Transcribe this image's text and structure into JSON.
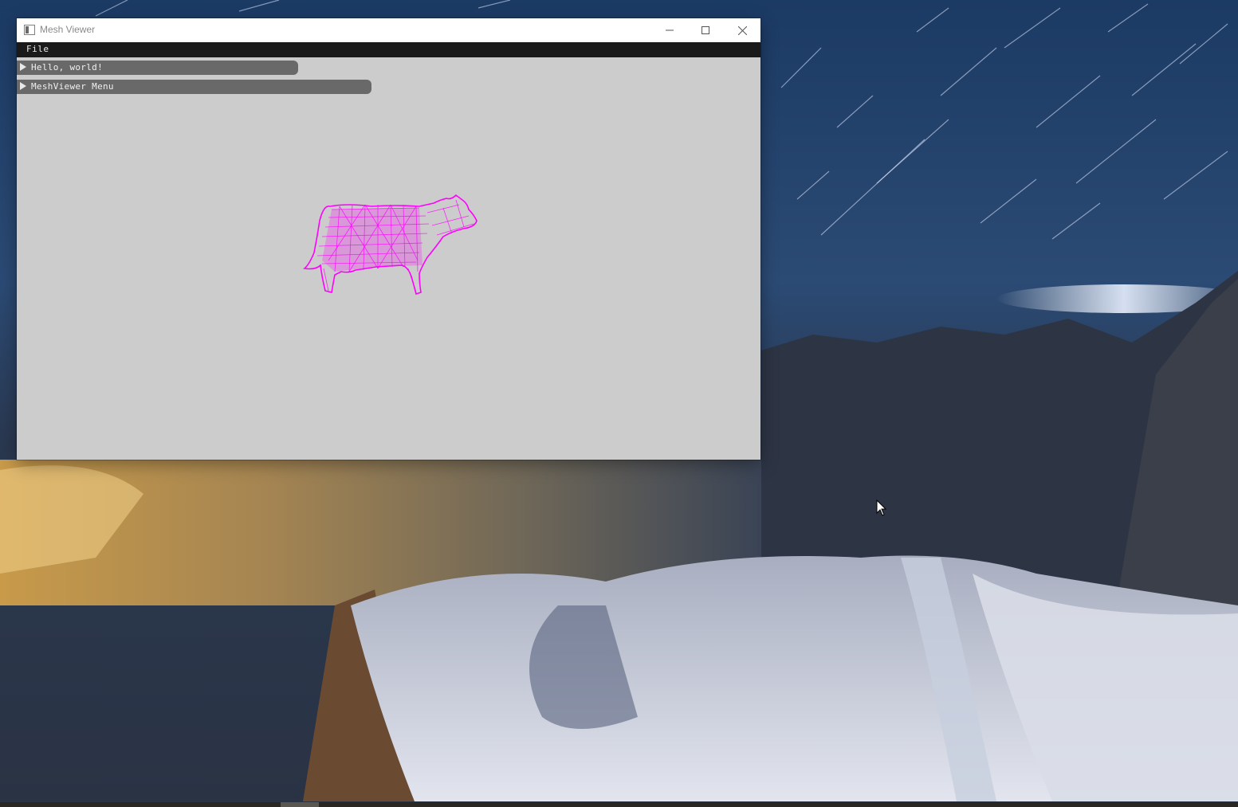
{
  "window": {
    "title": "Mesh Viewer"
  },
  "menubar": {
    "file_label": "File"
  },
  "panels": {
    "hello_label": "Hello, world!",
    "meshviewer_label": "MeshViewer Menu"
  },
  "viewport": {
    "background_color": "#cccccc",
    "mesh_color": "#ff00ff",
    "mesh_render_mode": "wireframe"
  },
  "icons": {
    "app": "app-icon",
    "minimize": "minimize-icon",
    "maximize": "maximize-icon",
    "close": "close-icon",
    "cursor": "mouse-cursor-icon"
  }
}
